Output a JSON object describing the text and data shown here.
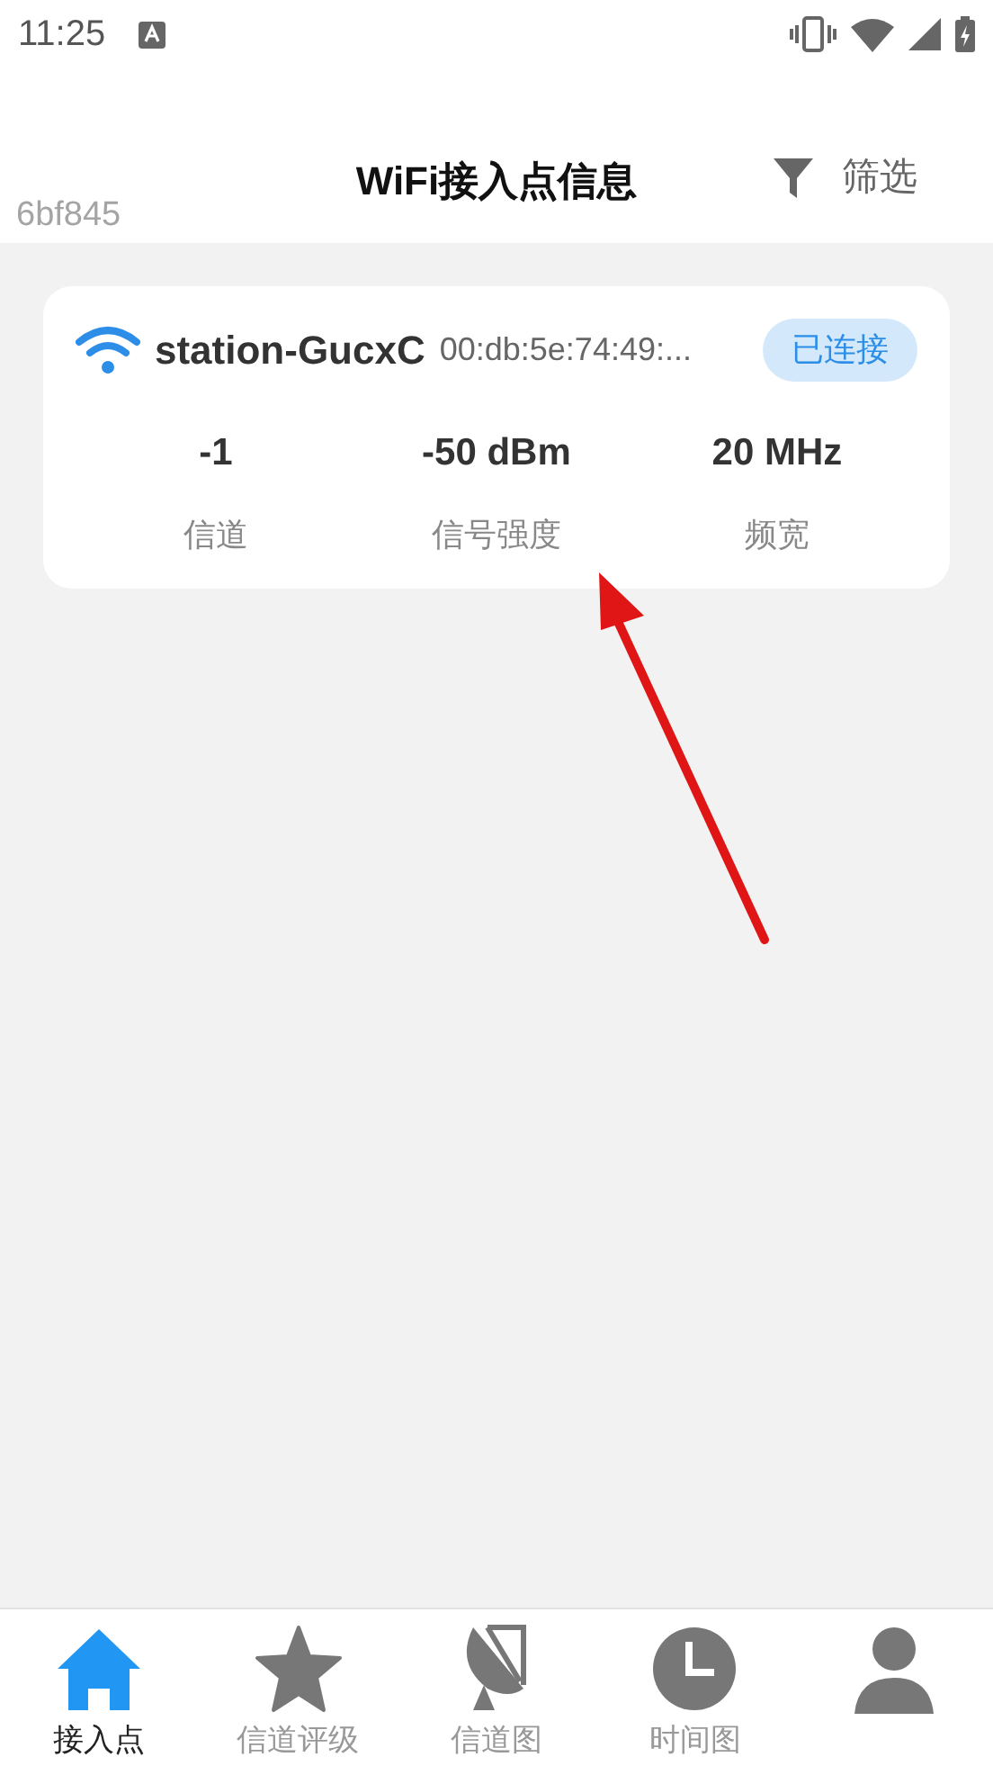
{
  "status_bar": {
    "time": "11:25"
  },
  "header": {
    "title": "WiFi接入点信息",
    "filter": "筛选",
    "build_id": "6bf845"
  },
  "access_points": [
    {
      "ssid": "station-GucxC",
      "bssid": "00:db:5e:74:49:...",
      "connected": true,
      "status": "已连接",
      "stats": [
        {
          "value": "-1",
          "label": "信道"
        },
        {
          "value": "-50 dBm",
          "label": "信号强度"
        },
        {
          "value": "20 MHz",
          "label": "频宽"
        }
      ]
    }
  ],
  "annotation": {
    "kind": "arrow"
  },
  "bottom_nav": [
    {
      "kind": "home",
      "label": "接入点",
      "selected": true
    },
    {
      "kind": "star",
      "label": "信道评级",
      "selected": false
    },
    {
      "kind": "dish",
      "label": "信道图",
      "selected": false
    },
    {
      "kind": "clock",
      "label": "时间图",
      "selected": false
    },
    {
      "kind": "person",
      "selected": false
    }
  ]
}
